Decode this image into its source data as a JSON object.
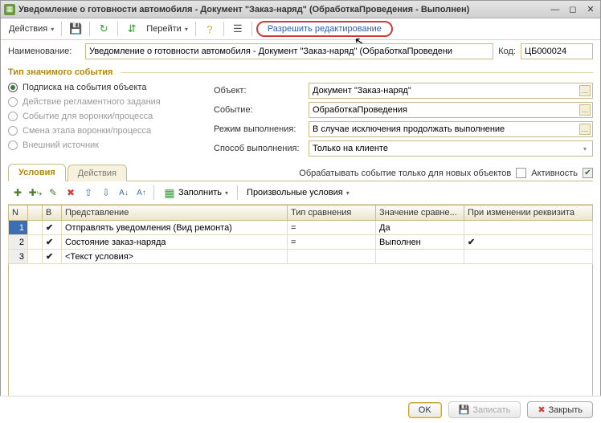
{
  "window": {
    "title": "Уведомление о готовности автомобиля - Документ \"Заказ-наряд\" (ОбработкаПроведения - Выполнен)"
  },
  "toolbar": {
    "actions": "Действия",
    "go": "Перейти",
    "allow_edit": "Разрешить редактирование"
  },
  "form": {
    "name_label": "Наименование:",
    "name_value": "Уведомление о готовности автомобиля - Документ \"Заказ-наряд\" (ОбработкаПроведени",
    "code_label": "Код:",
    "code_value": "ЦБ000024"
  },
  "event_type": {
    "legend": "Тип значимого события",
    "options": [
      "Подписка на события объекта",
      "Действие регламентного задания",
      "Событие для воронки/процесса",
      "Смена этапа воронки/процесса",
      "Внешний источник"
    ]
  },
  "props": {
    "object_label": "Объект:",
    "object_value": "Документ \"Заказ-наряд\"",
    "event_label": "Событие:",
    "event_value": "ОбработкаПроведения",
    "mode_label": "Режим выполнения:",
    "mode_value": "В случае исключения продолжать выполнение",
    "method_label": "Способ выполнения:",
    "method_value": "Только на клиенте"
  },
  "tabs": {
    "conditions": "Условия",
    "actions": "Действия",
    "only_new": "Обрабатывать событие только для новых объектов",
    "activity": "Активность"
  },
  "subtoolbar": {
    "fill": "Заполнить",
    "arbitrary": "Произвольные условия"
  },
  "grid": {
    "headers": {
      "n": "N",
      "b": "В",
      "repr": "Представление",
      "cmp": "Тип сравнения",
      "val": "Значение сравне...",
      "onchange": "При изменении реквизита"
    },
    "rows": [
      {
        "n": "1",
        "b": true,
        "repr": "Отправлять уведомления (Вид ремонта)",
        "cmp": "=",
        "val": "Да",
        "onchange": false
      },
      {
        "n": "2",
        "b": true,
        "repr": "Состояние заказ-наряда",
        "cmp": "=",
        "val": "Выполнен",
        "onchange": true
      },
      {
        "n": "3",
        "b": true,
        "repr": "<Текст условия>",
        "cmp": "",
        "val": "",
        "onchange": false
      }
    ]
  },
  "footer": {
    "ok": "OK",
    "save": "Записать",
    "close": "Закрыть"
  }
}
